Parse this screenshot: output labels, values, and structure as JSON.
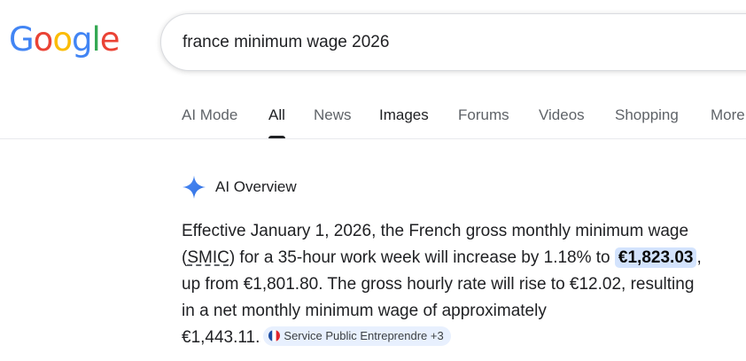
{
  "logo": {
    "letters": [
      "G",
      "o",
      "o",
      "g",
      "l",
      "e"
    ],
    "colors": [
      "#4285f4",
      "#ea4335",
      "#fbbc05",
      "#4285f4",
      "#34a853",
      "#ea4335"
    ]
  },
  "search": {
    "query": "france minimum wage 2026"
  },
  "tabs": [
    {
      "label": "AI Mode"
    },
    {
      "label": "All"
    },
    {
      "label": "News"
    },
    {
      "label": "Images"
    },
    {
      "label": "Forums"
    },
    {
      "label": "Videos"
    },
    {
      "label": "Shopping"
    },
    {
      "label": "More"
    }
  ],
  "active_tab": "All",
  "ai_overview": {
    "title": "AI Overview",
    "icon": "sparkle-icon",
    "line1": "Effective January 1, 2026, the French gross monthly minimum wage",
    "line2_open": "(",
    "line2_abbr": "SMIC",
    "line2_mid": ") for a 35-hour work week will increase by 1.18% to ",
    "highlight_value": "€1,823.03",
    "line2_end": ",",
    "line3": "up from €1,801.80. The gross hourly rate will rise to €12.02, resulting",
    "line4": "in a net monthly minimum wage of approximately",
    "line5": "€1,443.11.",
    "source_chip": {
      "label": "Service Public Entreprendre +3",
      "icon": "france-flag-icon"
    }
  },
  "colors": {
    "highlight_bg": "#d3e3fd",
    "chip_bg": "#e8f0fe",
    "sparkle": "#4285f4"
  }
}
